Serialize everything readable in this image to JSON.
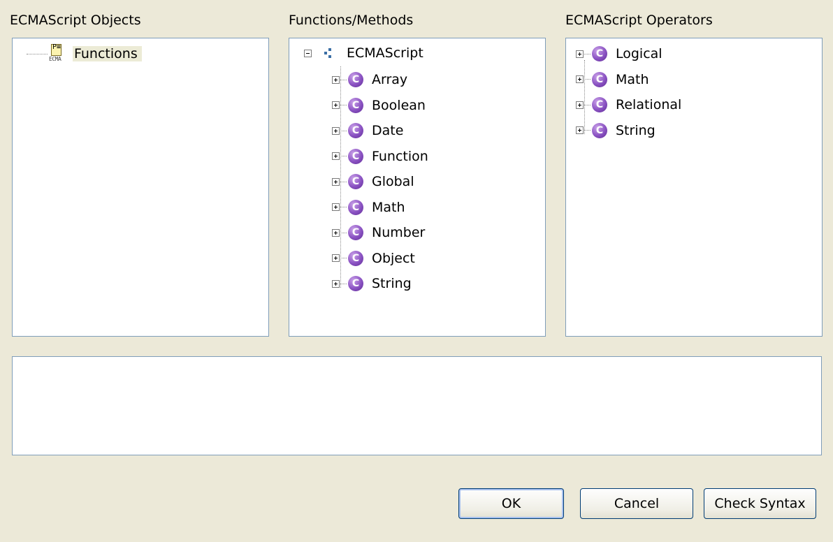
{
  "objects_pane": {
    "label": "ECMAScript Objects",
    "items": [
      {
        "label": "Functions",
        "icon": "ecma-functions-icon",
        "icon_text_top": "P≡",
        "icon_text_bottom": "ECMA"
      }
    ]
  },
  "functions_pane": {
    "label": "Functions/Methods",
    "root": "ECMAScript",
    "items": [
      "Array",
      "Boolean",
      "Date",
      "Function",
      "Global",
      "Math",
      "Number",
      "Object",
      "String"
    ],
    "class_icon_letter": "C"
  },
  "operators_pane": {
    "label": "ECMAScript Operators",
    "items": [
      "Logical",
      "Math",
      "Relational",
      "String"
    ]
  },
  "expression_area": {
    "value": ""
  },
  "buttons": {
    "ok": "OK",
    "cancel": "Cancel",
    "check_syntax": "Check Syntax"
  },
  "colors": {
    "background": "#ece9d8",
    "class_icon": "#8a52c2",
    "border": "#7f9db9",
    "button_border": "#003c74"
  }
}
